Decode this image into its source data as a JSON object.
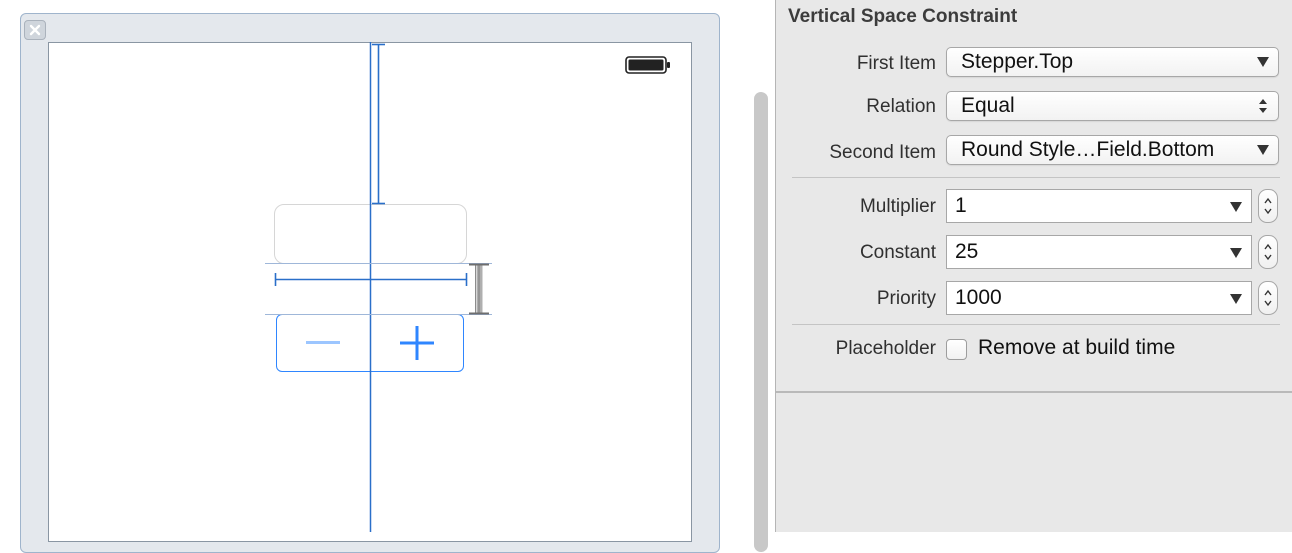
{
  "canvas": {
    "close_icon": "close-x-icon",
    "battery_icon": "battery-full-icon",
    "stepper": {
      "minus_symbol": "−",
      "plus_symbol": "+"
    }
  },
  "inspector": {
    "title": "Vertical Space Constraint",
    "first_item": {
      "label": "First Item",
      "value": "Stepper.Top"
    },
    "relation": {
      "label": "Relation",
      "value": "Equal"
    },
    "second_item": {
      "label": "Second Item",
      "value": "Round Style…Field.Bottom"
    },
    "multiplier": {
      "label": "Multiplier",
      "value": "1"
    },
    "constant": {
      "label": "Constant",
      "value": "25"
    },
    "priority": {
      "label": "Priority",
      "value": "1000"
    },
    "placeholder": {
      "label": "Placeholder",
      "option": "Remove at build time",
      "checked": false
    }
  },
  "colors": {
    "constraint_blue": "#2a6fc9",
    "stepper_blue": "#2f86ff",
    "inspector_bg": "#e8e8e8"
  }
}
